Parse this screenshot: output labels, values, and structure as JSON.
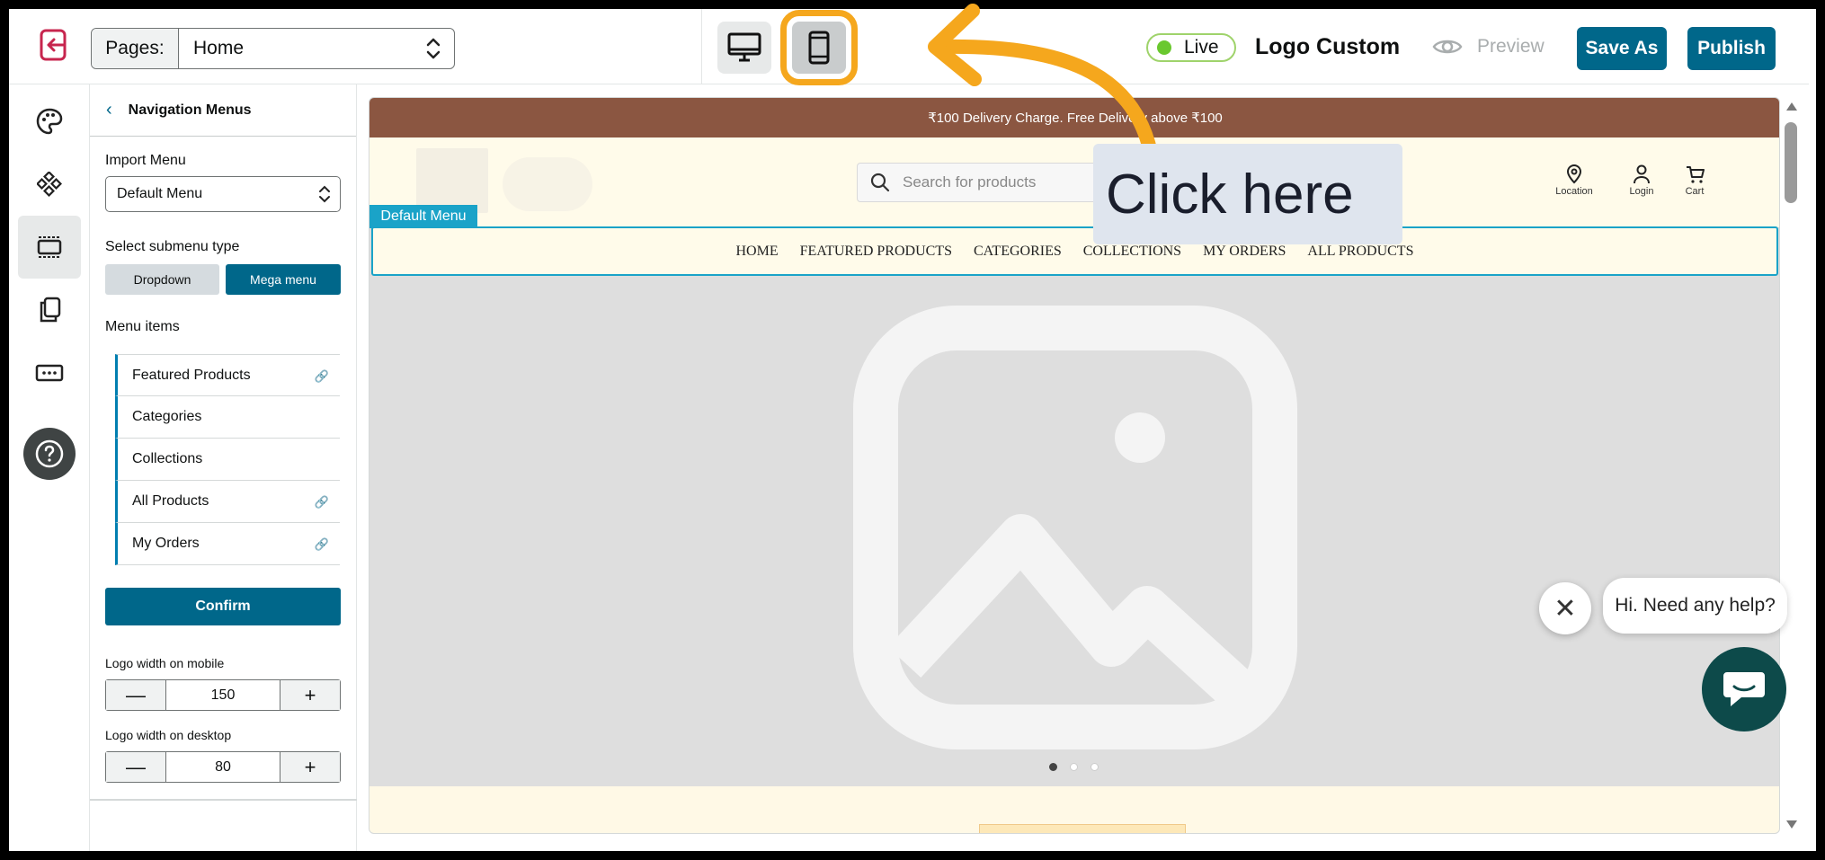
{
  "topbar": {
    "pages_label": "Pages:",
    "pages_value": "Home",
    "live_label": "Live",
    "store_name": "Logo Custom",
    "preview_label": "Preview",
    "save_as_label": "Save As",
    "publish_label": "Publish",
    "accent_color": "#00678a",
    "highlight_color": "#f5a71d"
  },
  "rail": {
    "icons": [
      "palette-icon",
      "components-icon",
      "header-layout-icon",
      "pages-icon",
      "footer-icon",
      "help-icon"
    ]
  },
  "panel": {
    "back_title": "Navigation Menus",
    "import_label": "Import Menu",
    "import_value": "Default Menu",
    "submenu_label": "Select submenu type",
    "dropdown_label": "Dropdown",
    "mega_label": "Mega menu",
    "menu_items_label": "Menu items",
    "menu_items": [
      {
        "label": "Featured Products",
        "link": true
      },
      {
        "label": "Categories",
        "link": false
      },
      {
        "label": "Collections",
        "link": false
      },
      {
        "label": "All Products",
        "link": true
      },
      {
        "label": "My Orders",
        "link": true
      }
    ],
    "confirm_label": "Confirm",
    "logo_mobile_label": "Logo width on mobile",
    "logo_mobile_value": "150",
    "logo_desktop_label": "Logo width on desktop",
    "logo_desktop_value": "80",
    "minus": "—",
    "plus": "+"
  },
  "storefront": {
    "announcement": "₹100 Delivery Charge. Free Delivery above ₹100",
    "search_placeholder": "Search for products",
    "location_label": "Location",
    "login_label": "Login",
    "cart_label": "Cart",
    "menu_tag": "Default Menu",
    "nav": [
      "HOME",
      "FEATURED PRODUCTS",
      "CATEGORIES",
      "COLLECTIONS",
      "MY ORDERS",
      "ALL PRODUCTS"
    ],
    "announcement_color": "#8b5641",
    "header_bg": "#fffbea",
    "nav_border_color": "#1aa3c8"
  },
  "overlay": {
    "callout_text": "Click here",
    "chat_text": "Hi. Need any help?",
    "chat_close": "✕"
  }
}
